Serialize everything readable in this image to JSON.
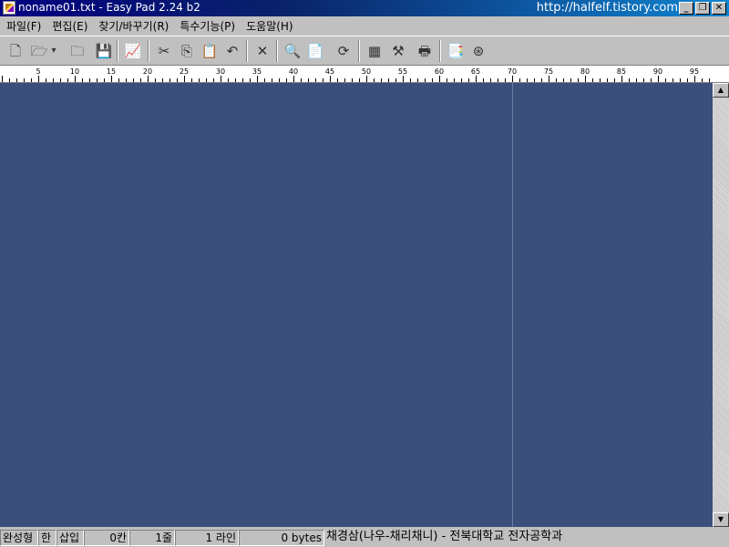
{
  "window": {
    "title": "noname01.txt - Easy Pad 2.24 b2",
    "url_text": "http://halfelf.tistory.com",
    "min_glyph": "_",
    "max_glyph": "❐",
    "close_glyph": "✕"
  },
  "menu": [
    {
      "label": "파일(F)"
    },
    {
      "label": "편집(E)"
    },
    {
      "label": "찾기/바꾸기(R)"
    },
    {
      "label": "특수기능(P)"
    },
    {
      "label": "도움말(H)"
    }
  ],
  "toolbar": {
    "buttons": [
      {
        "name": "new-file",
        "icon": "new-document-icon",
        "glyph": "🗋"
      },
      {
        "name": "open-file",
        "icon": "folder-open-icon",
        "glyph": "🗁"
      },
      {
        "name": "open-dropdown",
        "icon": "chevron-down-icon",
        "glyph": "▾"
      },
      {
        "name": "save-folder",
        "icon": "folder-save-icon",
        "glyph": "🗀"
      },
      {
        "name": "save",
        "icon": "floppy-disk-icon",
        "glyph": "💾"
      },
      {
        "name": "chart",
        "icon": "chart-icon",
        "glyph": "📈"
      },
      {
        "name": "cut",
        "icon": "scissors-icon",
        "glyph": "✂"
      },
      {
        "name": "copy",
        "icon": "copy-icon",
        "glyph": "⎘"
      },
      {
        "name": "paste",
        "icon": "paste-icon",
        "glyph": "📋"
      },
      {
        "name": "undo",
        "icon": "undo-icon",
        "glyph": "↶"
      },
      {
        "name": "delete",
        "icon": "close-icon",
        "glyph": "✕"
      },
      {
        "name": "find",
        "icon": "magnifier-icon",
        "glyph": "🔍"
      },
      {
        "name": "clipboard",
        "icon": "clipboard-icon",
        "glyph": "📄"
      },
      {
        "name": "refresh",
        "icon": "refresh-icon",
        "glyph": "⟳"
      },
      {
        "name": "book",
        "icon": "book-icon",
        "glyph": "▦"
      },
      {
        "name": "tools",
        "icon": "tools-icon",
        "glyph": "⚒"
      },
      {
        "name": "print",
        "icon": "printer-icon",
        "glyph": "🖶"
      },
      {
        "name": "help",
        "icon": "help-document-icon",
        "glyph": "📑"
      },
      {
        "name": "web",
        "icon": "globe-icon",
        "glyph": "⊛"
      }
    ]
  },
  "ruler": {
    "labels": [
      "5",
      "10",
      "15",
      "20",
      "25",
      "30",
      "35",
      "40",
      "45",
      "50",
      "55",
      "60",
      "65",
      "70",
      "75",
      "80",
      "85",
      "90",
      "95"
    ]
  },
  "editor": {
    "content": "",
    "background": "#3b4f7a"
  },
  "scrollbar": {
    "up_glyph": "▲",
    "down_glyph": "▼"
  },
  "status": {
    "input_mode": "완성형",
    "lang": "한",
    "insert_mode": "삽입",
    "column": "0칸",
    "row": "1줄",
    "lines": "1 라인",
    "bytes": "0 bytes",
    "credit": "채경삼(나우-채리채니) - 전북대학교 전자공학과"
  }
}
